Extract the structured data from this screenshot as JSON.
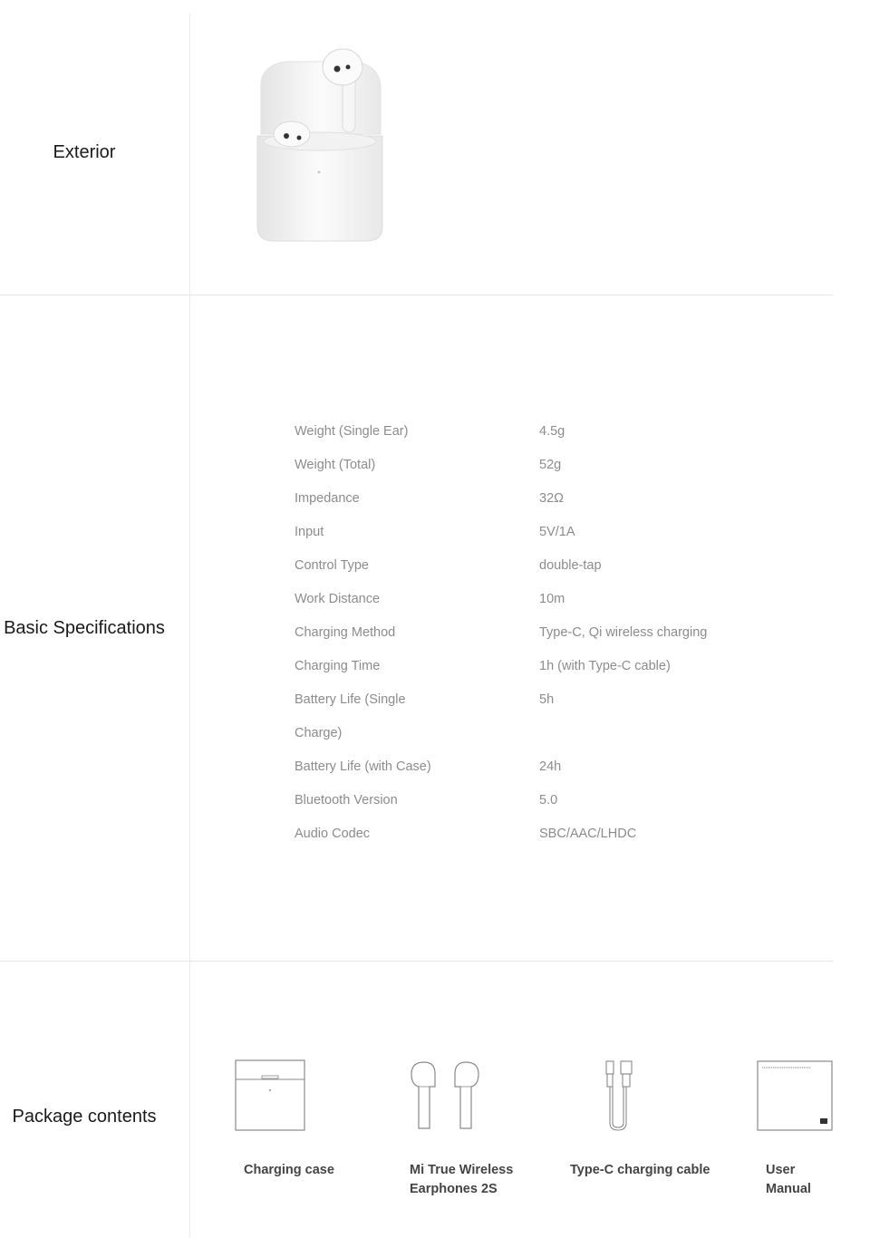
{
  "sections": {
    "exterior": "Exterior",
    "basic_specifications": "Basic Specifications",
    "package_contents": "Package contents"
  },
  "specs": [
    {
      "key": "Weight (Single Ear)",
      "value": "4.5g"
    },
    {
      "key": "Weight (Total)",
      "value": "52g"
    },
    {
      "key": "Impedance",
      "value": "32Ω"
    },
    {
      "key": "Input",
      "value": "5V/1A"
    },
    {
      "key": "Control Type",
      "value": "double-tap"
    },
    {
      "key": "Work Distance",
      "value": "10m"
    },
    {
      "key": "Charging Method",
      "value": "Type-C, Qi wireless charging"
    },
    {
      "key": "Charging Time",
      "value": "1h (with Type-C cable)"
    },
    {
      "key": "Battery Life (Single",
      "value": "5h"
    },
    {
      "key": "Charge)",
      "value": ""
    },
    {
      "key": "Battery Life (with Case)",
      "value": "24h"
    },
    {
      "key": "Bluetooth Version",
      "value": "5.0"
    },
    {
      "key": "Audio Codec",
      "value": "SBC/AAC/LHDC"
    }
  ],
  "package": [
    {
      "line1": "Charging case",
      "line2": "",
      "icon": "charging-case-icon"
    },
    {
      "line1": "Mi True Wireless",
      "line2": "Earphones 2S",
      "icon": "earphones-icon"
    },
    {
      "line1": "Type-C charging cable",
      "line2": "",
      "icon": "usb-cable-icon"
    },
    {
      "line1": "User",
      "line2": "Manual",
      "icon": "manual-icon"
    }
  ],
  "colors": {
    "divider": "#e6e6e6",
    "spec_text": "#8c8c8c",
    "label_text": "#1a1a1a"
  }
}
